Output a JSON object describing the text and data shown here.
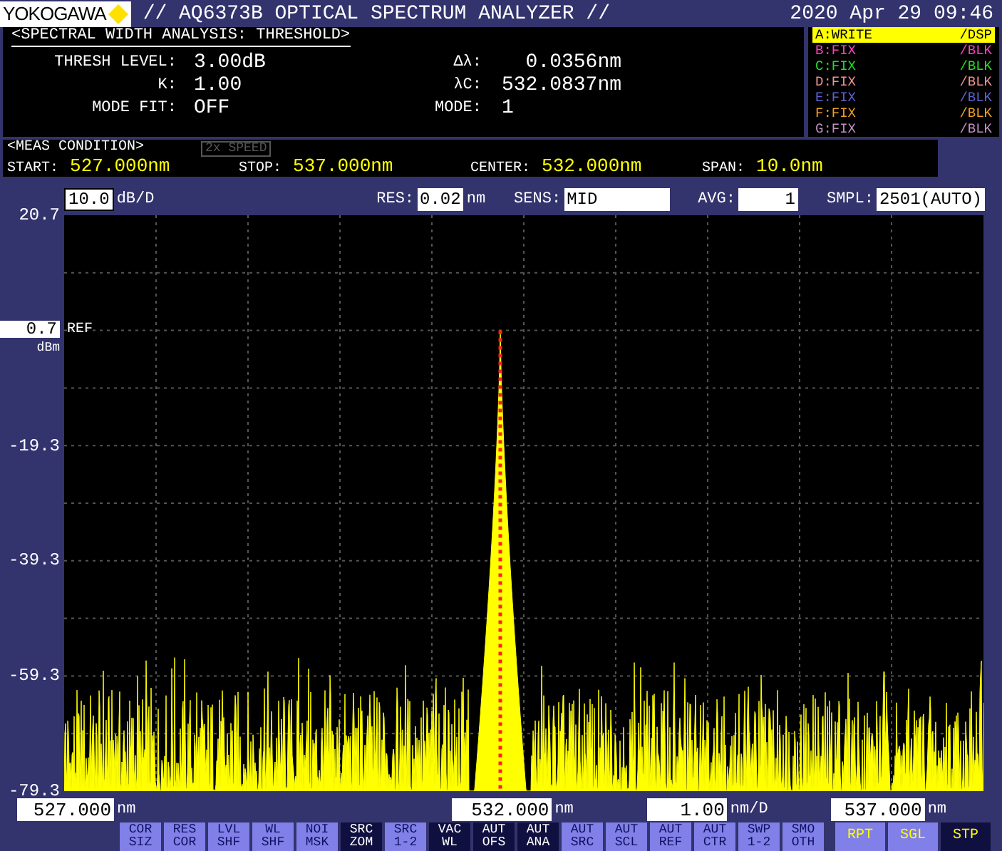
{
  "header": {
    "brand": "YOKOGAWA",
    "title": "// AQ6373B OPTICAL SPECTRUM ANALYZER //",
    "datetime": "2020 Apr 29 09:46"
  },
  "analysis": {
    "title": "<SPECTRAL WIDTH ANALYSIS: THRESHOLD>",
    "left": [
      {
        "label": "THRESH LEVEL:",
        "value": "3.00dB"
      },
      {
        "label": "K:",
        "value": "1.00"
      },
      {
        "label": "MODE FIT:",
        "value": "OFF"
      }
    ],
    "right": [
      {
        "label": "Δλ:",
        "value": "0.0356nm"
      },
      {
        "label": "λC:",
        "value": "532.0837nm"
      },
      {
        "label": "MODE:",
        "value": "1"
      }
    ]
  },
  "traces": [
    {
      "label": "A:WRITE",
      "mode": "/DSP",
      "color": "#ffff00",
      "selected": true
    },
    {
      "label": "B:FIX",
      "mode": "/BLK",
      "color": "#ff40c0",
      "selected": false
    },
    {
      "label": "C:FIX",
      "mode": "/BLK",
      "color": "#20e020",
      "selected": false
    },
    {
      "label": "D:FIX",
      "mode": "/BLK",
      "color": "#f09090",
      "selected": false
    },
    {
      "label": "E:FIX",
      "mode": "/BLK",
      "color": "#6060d0",
      "selected": false
    },
    {
      "label": "F:FIX",
      "mode": "/BLK",
      "color": "#f0a020",
      "selected": false
    },
    {
      "label": "G:FIX",
      "mode": "/BLK",
      "color": "#c090c0",
      "selected": false
    }
  ],
  "meas_condition": {
    "title": "<MEAS CONDITION>",
    "speed_badge": "2x SPEED",
    "items": [
      {
        "label": "START:",
        "value": "527.000nm"
      },
      {
        "label": "STOP:",
        "value": "537.000nm"
      },
      {
        "label": "CENTER:",
        "value": "532.000nm"
      },
      {
        "label": "SPAN:",
        "value": "10.0nm"
      }
    ]
  },
  "settings": {
    "scale": {
      "value": "10.0",
      "unit": "dB/D"
    },
    "items": [
      {
        "label": "RES:",
        "value": "0.02",
        "unit": "nm"
      },
      {
        "label": "SENS:",
        "value": "MID"
      },
      {
        "label": "AVG:",
        "value": "1"
      },
      {
        "label": "SMPL:",
        "value": "2501(AUTO)"
      }
    ]
  },
  "chart": {
    "y_labels": [
      "20.7",
      "-19.3",
      "-39.3",
      "-59.3",
      "-79.3"
    ],
    "ref": {
      "value": "0.7",
      "unit": "dBm",
      "label": "REF"
    }
  },
  "x_axis": [
    {
      "value": "527.000",
      "unit": "nm"
    },
    {
      "value": "532.000",
      "unit": "nm"
    },
    {
      "value": "1.00",
      "unit": "nm/D"
    },
    {
      "value": "537.000",
      "unit": "nm"
    }
  ],
  "softkeys": [
    {
      "top": "COR",
      "bottom": "SIZ",
      "active": false
    },
    {
      "top": "RES",
      "bottom": "COR",
      "active": false
    },
    {
      "top": "LVL",
      "bottom": "SHF",
      "active": false
    },
    {
      "top": "WL",
      "bottom": "SHF",
      "active": false
    },
    {
      "top": "NOI",
      "bottom": "MSK",
      "active": false
    },
    {
      "top": "SRC",
      "bottom": "ZOM",
      "active": true
    },
    {
      "top": "SRC",
      "bottom": "1-2",
      "active": false
    },
    {
      "top": "VAC",
      "bottom": "WL",
      "active": true
    },
    {
      "top": "AUT",
      "bottom": "OFS",
      "active": true
    },
    {
      "top": "AUT",
      "bottom": "ANA",
      "active": true
    },
    {
      "top": "AUT",
      "bottom": "SRC",
      "active": false
    },
    {
      "top": "AUT",
      "bottom": "SCL",
      "active": false
    },
    {
      "top": "AUT",
      "bottom": "REF",
      "active": false
    },
    {
      "top": "AUT",
      "bottom": "CTR",
      "active": false
    },
    {
      "top": "SWP",
      "bottom": "1-2",
      "active": false
    },
    {
      "top": "SMO",
      "bottom": "OTH",
      "active": false
    }
  ],
  "sweep_keys": [
    {
      "label": "RPT",
      "active": false
    },
    {
      "label": "SGL",
      "active": false
    },
    {
      "label": "STP",
      "active": true
    }
  ]
}
